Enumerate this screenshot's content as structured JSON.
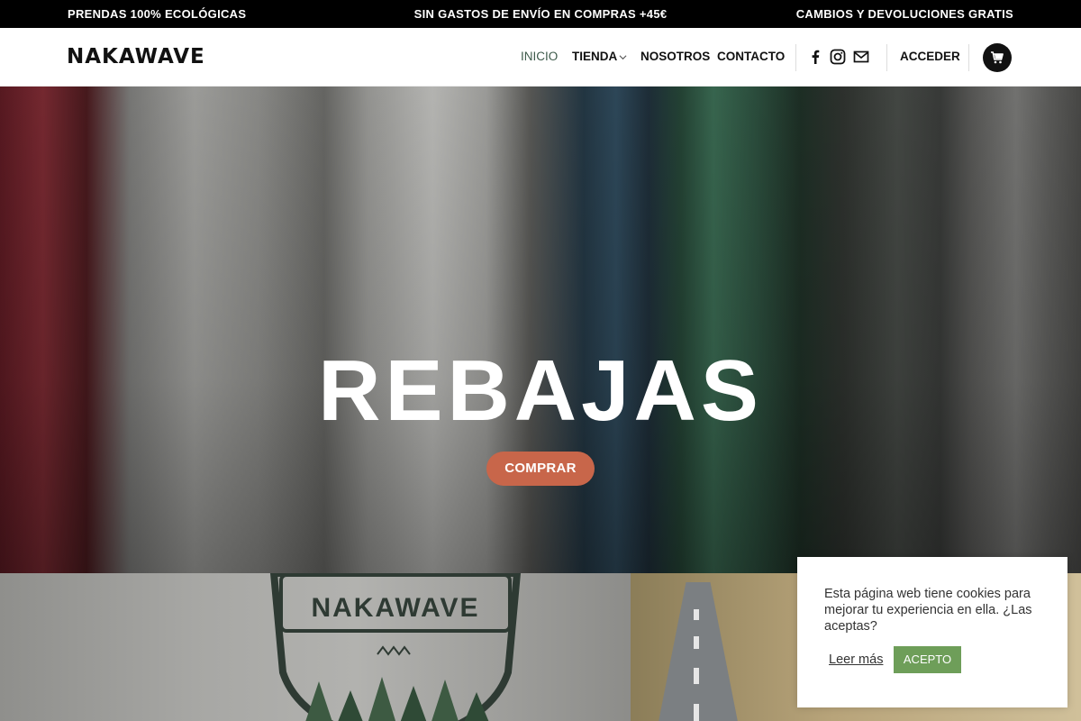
{
  "topbar": {
    "left": "PRENDAS 100% ECOLÓGICAS",
    "center": "SIN GASTOS DE ENVÍO EN COMPRAS +45€",
    "right": "CAMBIOS Y DEVOLUCIONES GRATIS"
  },
  "header": {
    "logo": "NAKAWAVE",
    "nav": [
      "INICIO",
      "TIENDA",
      "NOSOTROS",
      "CONTACTO"
    ],
    "active_nav": "INICIO",
    "social_icons": [
      "facebook-icon",
      "instagram-icon",
      "mail-icon"
    ],
    "login": "ACCEDER",
    "cart_icon": "cart-icon"
  },
  "hero": {
    "title": "REBAJAS",
    "button": "COMPRAR"
  },
  "section2": {
    "badge_text": "NAKAWAVE"
  },
  "cookie": {
    "text": "Esta página web tiene cookies para mejorar tu experiencia en ella. ¿Las aceptas?",
    "read_more": "Leer más",
    "accept": "ACEPTO"
  },
  "colors": {
    "accent_button": "#c8664a",
    "active_nav": "#3d5a4a",
    "cookie_accept": "#6e9e59"
  }
}
